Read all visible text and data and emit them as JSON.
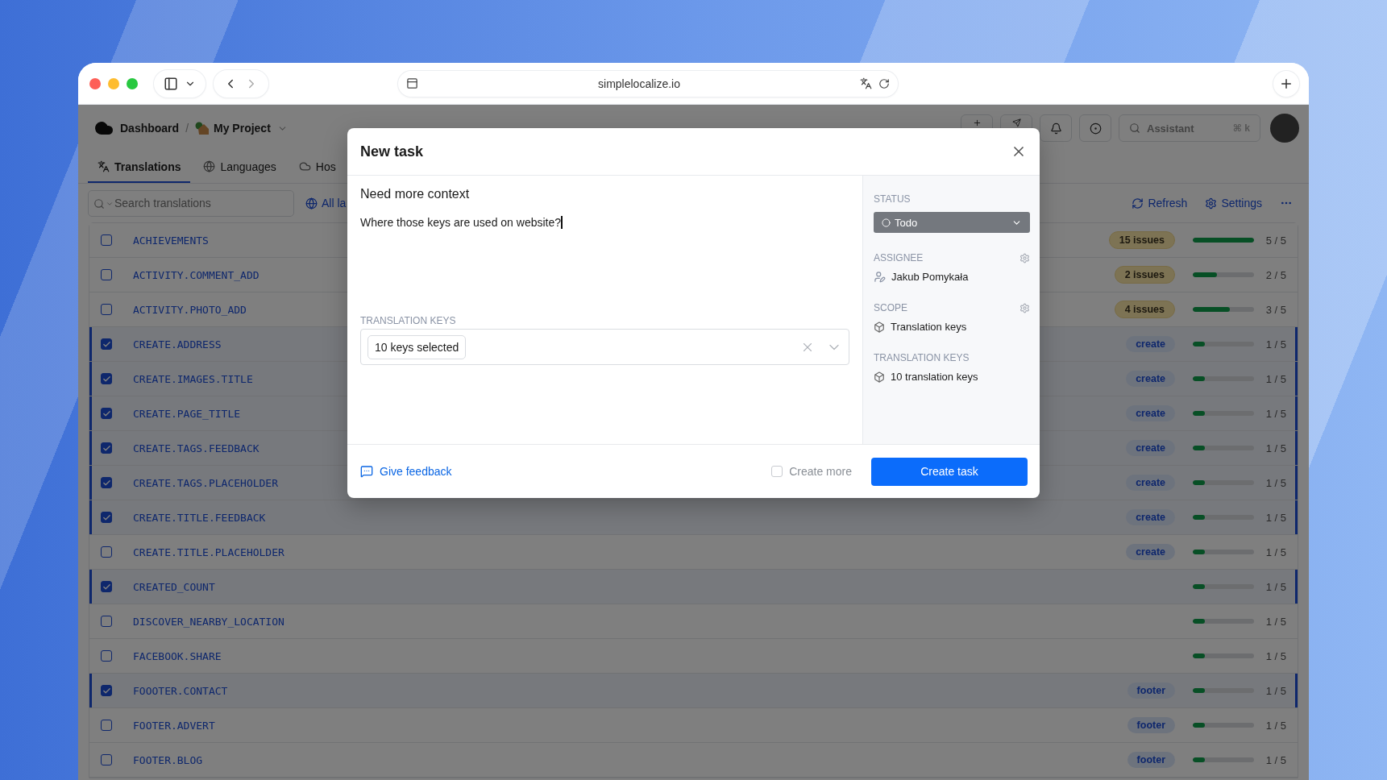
{
  "browser": {
    "url": "simplelocalize.io"
  },
  "app": {
    "breadcrumb": [
      {
        "label": "Dashboard"
      },
      {
        "label": "My Project"
      }
    ],
    "separator": "/",
    "tabs": [
      {
        "label": "Translations",
        "selected": true
      },
      {
        "label": "Languages",
        "selected": false
      },
      {
        "label": "Hos",
        "selected": false
      }
    ],
    "search": {
      "placeholder": "Search translations"
    },
    "language_filter": "All la",
    "assistant": {
      "placeholder": "Assistant",
      "shortcut": "⌘ k"
    },
    "actions": [
      {
        "label": "Refresh"
      },
      {
        "label": "Settings"
      }
    ]
  },
  "table": {
    "rows": [
      {
        "key": "ACHIEVEMENTS",
        "checked": false,
        "badge": {
          "kind": "issues",
          "text": "15 issues"
        },
        "level": 1,
        "progress": "5 / 5"
      },
      {
        "key": "ACTIVITY.COMMENT_ADD",
        "checked": false,
        "badge": {
          "kind": "issues",
          "text": "2 issues"
        },
        "level": 0.4,
        "progress": "2 / 5"
      },
      {
        "key": "ACTIVITY.PHOTO_ADD",
        "checked": false,
        "badge": {
          "kind": "issues",
          "text": "4 issues"
        },
        "level": 0.6,
        "progress": "3 / 5"
      },
      {
        "key": "CREATE.ADDRESS",
        "checked": true,
        "badge": {
          "kind": "tag",
          "text": "create"
        },
        "level": 0.2,
        "progress": "1 / 5"
      },
      {
        "key": "CREATE.IMAGES.TITLE",
        "checked": true,
        "badge": {
          "kind": "tag",
          "text": "create"
        },
        "level": 0.2,
        "progress": "1 / 5"
      },
      {
        "key": "CREATE.PAGE_TITLE",
        "checked": true,
        "badge": {
          "kind": "tag",
          "text": "create"
        },
        "level": 0.2,
        "progress": "1 / 5"
      },
      {
        "key": "CREATE.TAGS.FEEDBACK",
        "checked": true,
        "badge": {
          "kind": "tag",
          "text": "create"
        },
        "level": 0.2,
        "progress": "1 / 5"
      },
      {
        "key": "CREATE.TAGS.PLACEHOLDER",
        "checked": true,
        "badge": {
          "kind": "tag",
          "text": "create"
        },
        "level": 0.2,
        "progress": "1 / 5"
      },
      {
        "key": "CREATE.TITLE.FEEDBACK",
        "checked": true,
        "badge": {
          "kind": "tag",
          "text": "create"
        },
        "level": 0.2,
        "progress": "1 / 5"
      },
      {
        "key": "CREATE.TITLE.PLACEHOLDER",
        "checked": false,
        "badge": {
          "kind": "tag",
          "text": "create"
        },
        "level": 0.2,
        "progress": "1 / 5"
      },
      {
        "key": "CREATED_COUNT",
        "checked": true,
        "level": 0.2,
        "progress": "1 / 5"
      },
      {
        "key": "DISCOVER_NEARBY_LOCATION",
        "checked": false,
        "level": 0.2,
        "progress": "1 / 5"
      },
      {
        "key": "FACEBOOK.SHARE",
        "checked": false,
        "level": 0.2,
        "progress": "1 / 5"
      },
      {
        "key": "FOOOTER.CONTACT",
        "checked": true,
        "badge": {
          "kind": "tag",
          "text": "footer"
        },
        "level": 0.2,
        "progress": "1 / 5"
      },
      {
        "key": "FOOTER.ADVERT",
        "checked": false,
        "badge": {
          "kind": "tag",
          "text": "footer"
        },
        "level": 0.2,
        "progress": "1 / 5"
      },
      {
        "key": "FOOTER.BLOG",
        "checked": false,
        "badge": {
          "kind": "tag",
          "text": "footer"
        },
        "level": 0.2,
        "progress": "1 / 5"
      }
    ]
  },
  "dialog": {
    "title": "New task",
    "task_title": "Need more context",
    "description": "Where those keys are used on website?",
    "keys": {
      "label": "TRANSLATION KEYS",
      "chip": "10 keys selected"
    },
    "sidebar": [
      {
        "kind": "select",
        "label": "STATUS",
        "value": "Todo",
        "settings": false
      },
      {
        "kind": "person",
        "label": "ASSIGNEE",
        "value": "Jakub Pomykała",
        "settings": true
      },
      {
        "kind": "box",
        "label": "SCOPE",
        "value": "Translation keys",
        "settings": true
      },
      {
        "kind": "box",
        "label": "TRANSLATION KEYS",
        "value": "10 translation keys",
        "settings": false
      }
    ],
    "footer": {
      "feedback": "Give feedback",
      "create_more": {
        "label": "Create more",
        "checked": false
      },
      "submit": "Create task"
    }
  }
}
